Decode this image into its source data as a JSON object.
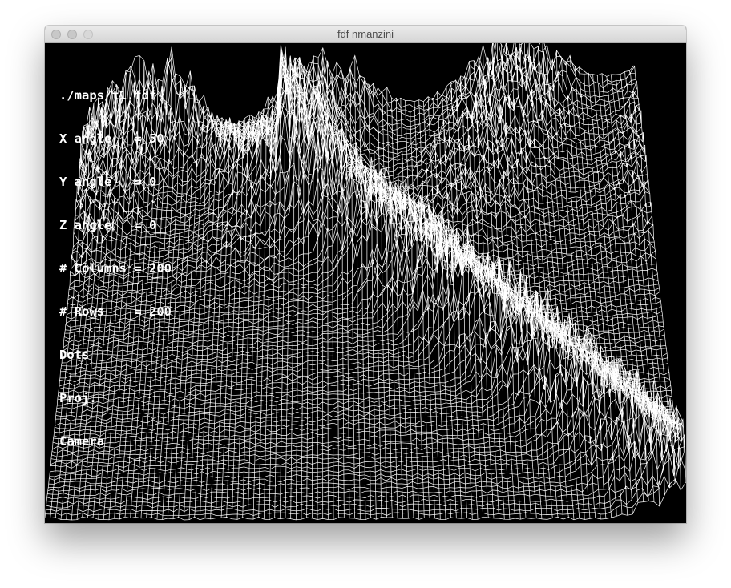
{
  "window": {
    "title": "fdf nmanzini"
  },
  "hud": {
    "file": "./maps/t1.fdf",
    "x_angle": "X angle   = 50",
    "y_angle": "Y angle   = 0",
    "z_angle": "Z angle   = 0",
    "columns": "# Columns = 200",
    "rows": "# Rows    = 200",
    "dots": "Dots",
    "proj": "Proj.",
    "camera": "Camera"
  },
  "mesh": {
    "line_color": "#ffffff",
    "background_color": "#000000"
  }
}
